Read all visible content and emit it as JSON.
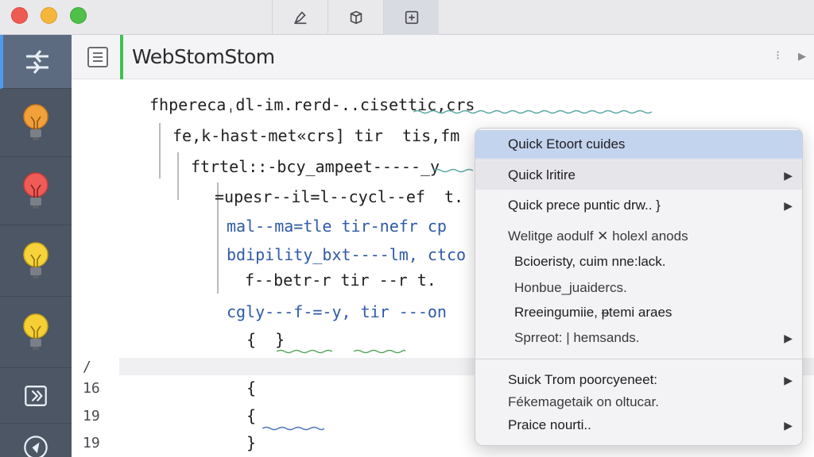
{
  "window": {
    "title_bar_tabs": [
      {
        "icon": "pen-icon",
        "active": false
      },
      {
        "icon": "cube-icon",
        "active": false
      },
      {
        "icon": "add-frame-icon",
        "active": true
      }
    ]
  },
  "activity_bar": {
    "items": [
      {
        "icon": "sliders-icon",
        "selected": true
      },
      {
        "icon": "lightbulb-orange-icon",
        "selected": false
      },
      {
        "icon": "lightbulb-red-icon",
        "selected": false
      },
      {
        "icon": "lightbulb-yellow-icon",
        "selected": false
      },
      {
        "icon": "lightbulb-yellow-icon",
        "selected": false
      },
      {
        "icon": "refresh-frame-icon",
        "selected": false
      },
      {
        "icon": "run-circle-icon",
        "selected": false
      }
    ]
  },
  "editor": {
    "title": "WebStomStom",
    "header_controls": [
      "⁝",
      "▶"
    ],
    "gutter_numbers": [
      "/",
      "16",
      "19",
      "19"
    ],
    "lines": [
      "fhperecaˌdl-im.rerd-..cisettic,crs",
      "fe,k-hast-met«crs] tir  tis,fm",
      "ftrtel::-bcy_ampeet-----_y",
      "=upesr--il=l--cycl--ef  t.",
      "mal--ma=tle tir-nefr cp",
      "bdipility_bxt----lm, ctco",
      "f--betr-r tir --r t.",
      "cgly---f-=-y, tir ---on",
      "{  }",
      "{",
      "{",
      "}"
    ]
  },
  "context_menu": {
    "items": [
      {
        "label": "Quick Etoort cuides",
        "arrow": false,
        "state": "highlight"
      },
      {
        "label": "Quick lritire",
        "arrow": true,
        "state": "hover"
      },
      {
        "label": "Quick prece puntic drw..  }",
        "arrow": true,
        "state": "normal"
      },
      {
        "label": "Welitge aodulf ✕ holexl anods",
        "arrow": false,
        "state": "normal"
      },
      {
        "label": "Bcioeristy, cuim nne:lack.",
        "arrow": false,
        "state": "normal"
      },
      {
        "label": "Honbue_juaidercs.",
        "arrow": false,
        "state": "normal"
      },
      {
        "label": "Rreeingumiie, ᵽtemi araes",
        "arrow": false,
        "state": "normal"
      },
      {
        "label": "Sprreot: | hemsands.",
        "arrow": true,
        "state": "normal"
      },
      {
        "label": "Suick Trom poorcyeneet:",
        "arrow": true,
        "state": "normal"
      },
      {
        "label": "Fékemagetaik on oltucar.",
        "arrow": false,
        "state": "normal"
      },
      {
        "label": "Praice nourti..",
        "arrow": true,
        "state": "normal"
      }
    ],
    "arrow_glyph": "▶"
  }
}
